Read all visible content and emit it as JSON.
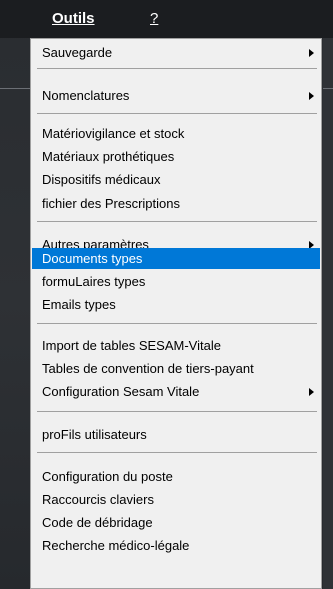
{
  "menubar": {
    "outils": "Outils",
    "help": "?"
  },
  "menu": {
    "items": [
      {
        "label": "Sauvegarde",
        "submenu": true
      },
      {
        "label": "Nomenclatures",
        "submenu": true
      },
      {
        "label": "Matériovigilance et stock",
        "submenu": false
      },
      {
        "label": "Matériaux prothétiques",
        "submenu": false
      },
      {
        "label": "Dispositifs médicaux",
        "submenu": false
      },
      {
        "label": "fichier des Prescriptions",
        "submenu": false
      },
      {
        "label": "Autres paramètres",
        "submenu": true
      },
      {
        "label": "Documents types",
        "submenu": false,
        "highlighted": true
      },
      {
        "label": "formuLaires types",
        "submenu": false
      },
      {
        "label": "Emails types",
        "submenu": false
      },
      {
        "label": "Import de tables SESAM-Vitale",
        "submenu": false
      },
      {
        "label": "Tables de convention de tiers-payant",
        "submenu": false
      },
      {
        "label": "Configuration Sesam Vitale",
        "submenu": true
      },
      {
        "label": "proFils utilisateurs",
        "submenu": false
      },
      {
        "label": "Configuration du poste",
        "submenu": false
      },
      {
        "label": "Raccourcis claviers",
        "submenu": false
      },
      {
        "label": "Code de débridage",
        "submenu": false
      },
      {
        "label": "Recherche médico-légale",
        "submenu": false
      }
    ]
  },
  "colors": {
    "highlight": "#0078d7",
    "menu_bg": "#f0f0f0"
  }
}
